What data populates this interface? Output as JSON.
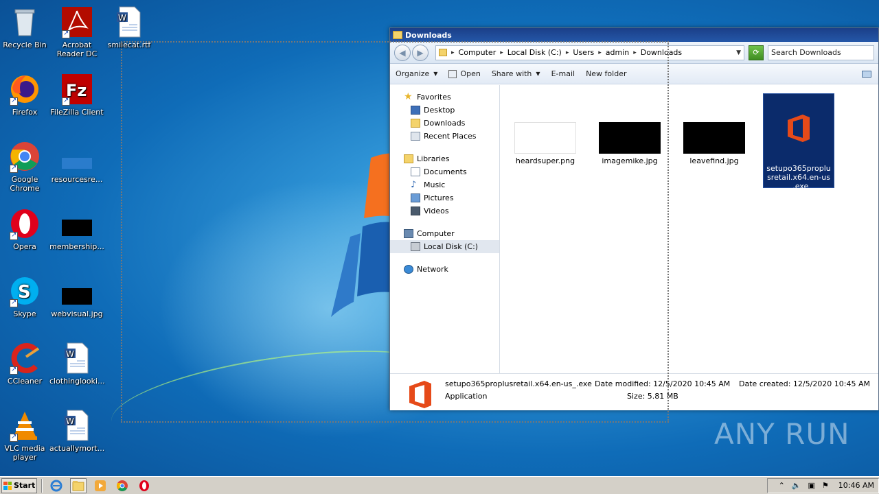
{
  "desktop": {
    "icons": [
      {
        "label": "Recycle Bin"
      },
      {
        "label": "Acrobat Reader DC"
      },
      {
        "label": "smilecat.rtf"
      },
      {
        "label": "Firefox"
      },
      {
        "label": "FileZilla Client"
      },
      {
        "label": "Google Chrome"
      },
      {
        "label": "resourcesre..."
      },
      {
        "label": "Opera"
      },
      {
        "label": "membership..."
      },
      {
        "label": "Skype"
      },
      {
        "label": "webvisual.jpg"
      },
      {
        "label": "CCleaner"
      },
      {
        "label": "clothinglooki..."
      },
      {
        "label": "VLC media player"
      },
      {
        "label": "actuallymort..."
      }
    ]
  },
  "explorer": {
    "title": "Downloads",
    "breadcrumb": [
      "Computer",
      "Local Disk (C:)",
      "Users",
      "admin",
      "Downloads"
    ],
    "search_placeholder": "Search Downloads",
    "toolbar": {
      "organize": "Organize",
      "open": "Open",
      "share_with": "Share with",
      "email": "E-mail",
      "new_folder": "New folder"
    },
    "nav": {
      "favorites": "Favorites",
      "desktop": "Desktop",
      "downloads": "Downloads",
      "recent_places": "Recent Places",
      "libraries": "Libraries",
      "documents": "Documents",
      "music": "Music",
      "pictures": "Pictures",
      "videos": "Videos",
      "computer": "Computer",
      "local_disk": "Local Disk (C:)",
      "network": "Network"
    },
    "files": [
      {
        "name": "heardsuper.png"
      },
      {
        "name": "imagemike.jpg"
      },
      {
        "name": "leavefind.jpg"
      },
      {
        "name": "setupo365proplusretail.x64.en-us_.exe"
      }
    ],
    "details": {
      "filename": "setupo365proplusretail.x64.en-us_.exe",
      "type": "Application",
      "modified_label": "Date modified:",
      "modified_value": "12/5/2020 10:45 AM",
      "size_label": "Size:",
      "size_value": "5.81 MB",
      "created_label": "Date created:",
      "created_value": "12/5/2020 10:45 AM"
    }
  },
  "taskbar": {
    "start": "Start",
    "clock": "10:46 AM"
  },
  "watermark": "ANY RUN",
  "colors": {
    "office_orange": "#e64a19",
    "selection_blue": "#0b2b6b"
  }
}
